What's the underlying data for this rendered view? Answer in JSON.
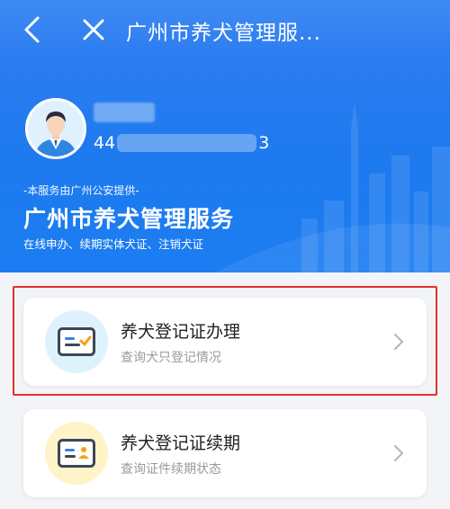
{
  "nav": {
    "title": "广州市养犬管理服...",
    "back_icon": "chevron-left-icon",
    "close_icon": "close-icon"
  },
  "profile": {
    "name_masked": "",
    "id_prefix": "44",
    "id_suffix": "3"
  },
  "service": {
    "provider": "-本服务由广州公安提供-",
    "title": "广州市养犬管理服务",
    "subtitle": "在线申办、续期实体犬证、注销犬证"
  },
  "cards": [
    {
      "title": "养犬登记证办理",
      "subtitle": "查询犬只登记情况",
      "icon": "license-card-check-icon",
      "highlighted": true
    },
    {
      "title": "养犬登记证续期",
      "subtitle": "查询证件续期状态",
      "icon": "license-card-person-icon",
      "highlighted": false
    }
  ],
  "colors": {
    "hero_blue": "#1e7aef",
    "highlight_red": "#e0312b",
    "card1_icon_bg": "#ddf2fc",
    "card2_icon_bg": "#fff3c8",
    "check_orange": "#f4a11c"
  }
}
